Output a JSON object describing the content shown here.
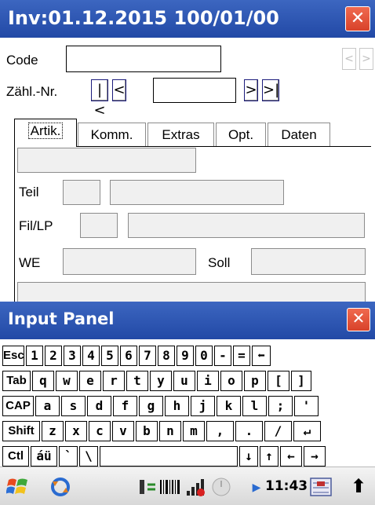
{
  "window": {
    "title": "Inv:01.12.2015 100/01/00",
    "close_glyph": "✕"
  },
  "form": {
    "code_label": "Code",
    "code_value": "",
    "code_prev": "<",
    "code_next": ">",
    "zahl_label": "Zähl.-Nr.",
    "zahl_value": "",
    "nav_first": "|<",
    "nav_prev": "<",
    "nav_next": ">",
    "nav_last": ">|",
    "tabs": [
      {
        "label": "Artik.",
        "active": true
      },
      {
        "label": "Komm.",
        "active": false
      },
      {
        "label": "Extras",
        "active": false
      },
      {
        "label": "Opt.",
        "active": false
      },
      {
        "label": "Daten",
        "active": false
      }
    ],
    "teil_label": "Teil",
    "fillp_label": "Fil/LP",
    "we_label": "WE",
    "soll_label": "Soll"
  },
  "input_panel": {
    "title": "Input Panel",
    "close_glyph": "✕",
    "rows": [
      [
        "Esc",
        "1",
        "2",
        "3",
        "4",
        "5",
        "6",
        "7",
        "8",
        "9",
        "0",
        "-",
        "=",
        "⬅"
      ],
      [
        "Tab",
        "q",
        "w",
        "e",
        "r",
        "t",
        "y",
        "u",
        "i",
        "o",
        "p",
        "[",
        "]"
      ],
      [
        "CAP",
        "a",
        "s",
        "d",
        "f",
        "g",
        "h",
        "j",
        "k",
        "l",
        ";",
        "'"
      ],
      [
        "Shift",
        "z",
        "x",
        "c",
        "v",
        "b",
        "n",
        "m",
        ",",
        ".",
        "/",
        "↵"
      ],
      [
        "Ctl",
        "áü",
        "`",
        "\\",
        "",
        "↓",
        "↑",
        "←",
        "→"
      ]
    ]
  },
  "taskbar": {
    "start_icon": "windows-flag-icon",
    "clock": "11:43",
    "sync_icon": "sync-icon",
    "barcode_icon": "barcode-icon",
    "signal_icon": "signal-icon",
    "power_icon": "power-icon",
    "keyboard_icon": "keyboard-icon",
    "arrow_icon": "up-arrow-icon",
    "colors": {
      "title_bar": "#2b52b0",
      "close": "#e4553a"
    }
  }
}
